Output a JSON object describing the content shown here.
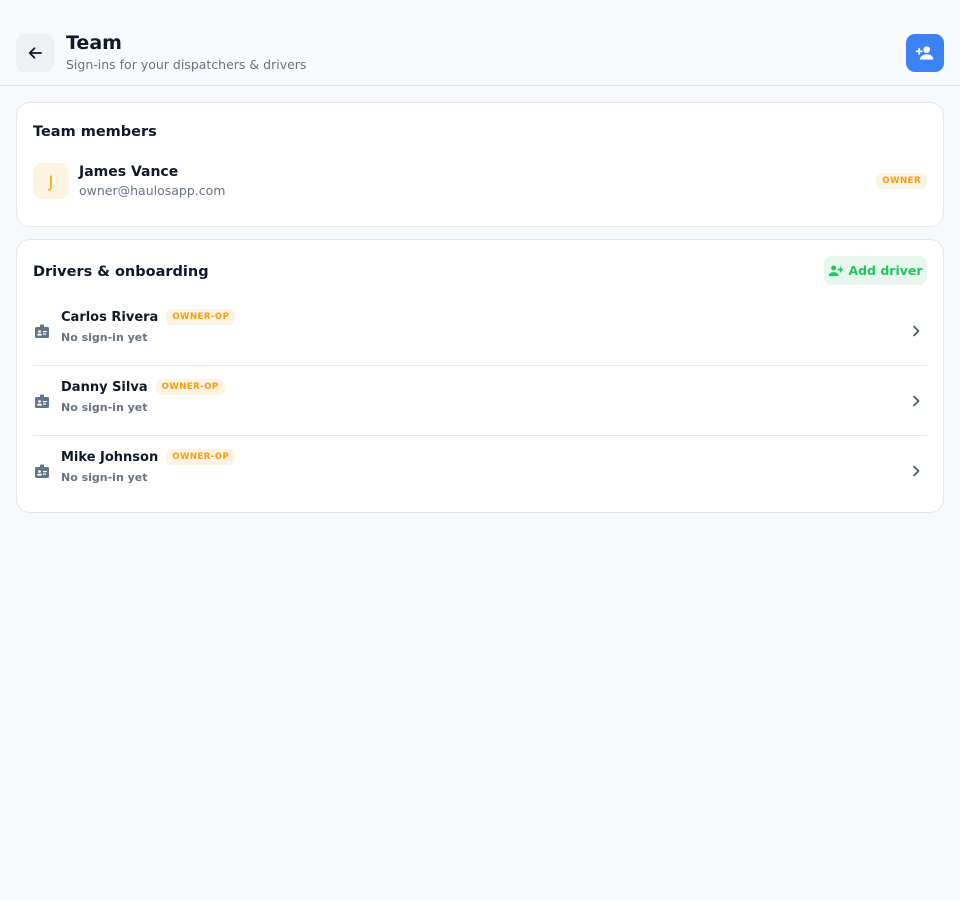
{
  "header": {
    "title": "Team",
    "subtitle": "Sign-ins for your dispatchers & drivers",
    "back_icon": "arrow-left-icon",
    "invite_icon": "person-add-icon"
  },
  "members": {
    "title": "Team members",
    "items": [
      {
        "initial": "J",
        "name": "James Vance",
        "email": "owner@haulosapp.com",
        "badge": "OWNER"
      }
    ]
  },
  "drivers": {
    "title": "Drivers & onboarding",
    "add_label": "Add driver",
    "items": [
      {
        "name": "Carlos Rivera",
        "badge": "OWNER-OP",
        "status": "No sign-in yet"
      },
      {
        "name": "Danny Silva",
        "badge": "OWNER-OP",
        "status": "No sign-in yet"
      },
      {
        "name": "Mike Johnson",
        "badge": "OWNER-OP",
        "status": "No sign-in yet"
      }
    ]
  },
  "colors": {
    "accent": "#3b82f6",
    "owner_badge": "#f59e0b",
    "add_green": "#22c55e",
    "background": "#f8f9fb"
  }
}
